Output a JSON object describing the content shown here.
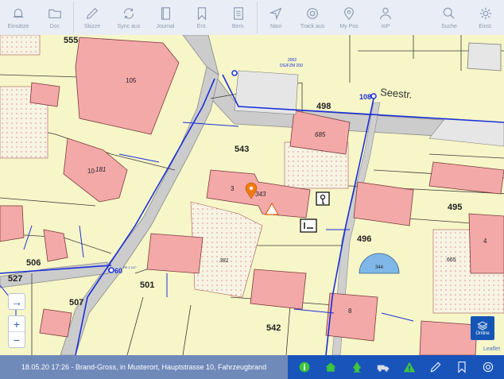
{
  "toolbar": {
    "items": [
      {
        "label": "Einsätze",
        "icon": "bell-icon"
      },
      {
        "label": "Doc",
        "icon": "folder-icon"
      },
      {
        "label": "Skizze",
        "icon": "pencil-icon"
      },
      {
        "label": "Sync aus",
        "icon": "sync-icon"
      },
      {
        "label": "Journal",
        "icon": "journal-icon"
      },
      {
        "label": "Ent.",
        "icon": "bookmark-icon"
      },
      {
        "label": "Bem.",
        "icon": "note-icon"
      },
      {
        "label": "Navi",
        "icon": "navigation-icon"
      },
      {
        "label": "Track aus",
        "icon": "lifebuoy-icon"
      },
      {
        "label": "My Pos",
        "icon": "location-pin-icon"
      },
      {
        "label": "IoP",
        "icon": "person-icon"
      },
      {
        "label": "Suche",
        "icon": "search-icon"
      },
      {
        "label": "Einst.",
        "icon": "gear-icon"
      }
    ]
  },
  "map": {
    "parcels": [
      "555",
      "105",
      "498",
      "685",
      "543",
      "3",
      "343",
      "10",
      "181",
      "495",
      "496",
      "4",
      "665",
      "344",
      "506",
      "501",
      "381",
      "527",
      "60",
      "507",
      "542",
      "8"
    ],
    "street_label": "Seestr.",
    "pipe_labels": [
      "2002",
      "DG/FZM 200",
      "108",
      "PE 1 1/2\""
    ],
    "zoom_in": "+",
    "zoom_out": "−",
    "locate": "→",
    "online_label": "Online",
    "attribution": "Leaflet"
  },
  "status": {
    "text": "18.05.20 17:26 - Brand-Gross, in Musterort, Hauptstrasse 10, Fahrzeugbrand"
  },
  "colors": {
    "accent": "#1854ba",
    "status_bg": "#6f89b9",
    "parcel": "#f6f6c8",
    "building": "#f4a9a9",
    "road": "#c8c8c8",
    "pipe": "#1a2fd8"
  }
}
